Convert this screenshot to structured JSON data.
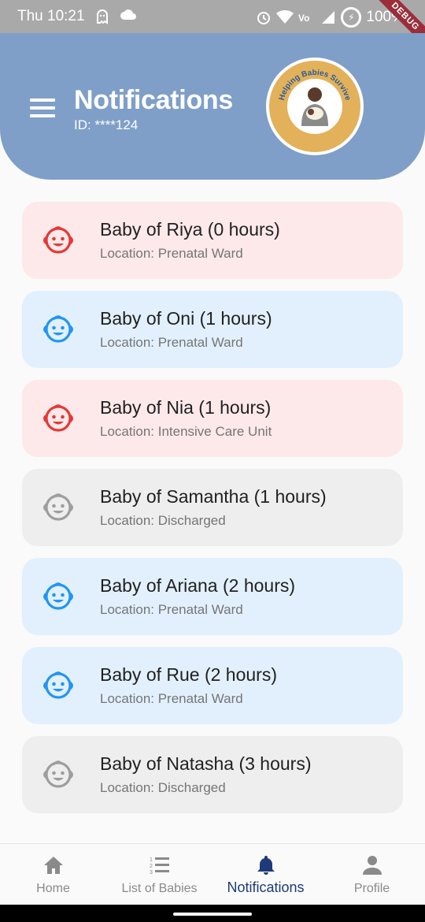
{
  "status_bar": {
    "time": "Thu 10:21",
    "battery": "100%",
    "debug_ribbon": "DEBUG"
  },
  "header": {
    "title": "Notifications",
    "id_label": "ID: ****124",
    "logo_text": "Helping Babies Survive",
    "background_color": "#7f9fc9"
  },
  "notifications": [
    {
      "title": "Baby of Riya (0 hours)",
      "location": "Location: Prenatal Ward",
      "status": "red",
      "icon": "baby-face-icon"
    },
    {
      "title": "Baby of Oni (1 hours)",
      "location": "Location: Prenatal Ward",
      "status": "blue",
      "icon": "baby-face-icon"
    },
    {
      "title": "Baby of Nia (1 hours)",
      "location": "Location: Intensive Care Unit",
      "status": "red",
      "icon": "baby-face-icon"
    },
    {
      "title": "Baby of Samantha (1 hours)",
      "location": "Location: Discharged",
      "status": "grey",
      "icon": "baby-face-icon"
    },
    {
      "title": "Baby of Ariana (2 hours)",
      "location": "Location: Prenatal Ward",
      "status": "blue",
      "icon": "baby-face-icon"
    },
    {
      "title": "Baby of Rue (2 hours)",
      "location": "Location: Prenatal Ward",
      "status": "blue",
      "icon": "baby-face-icon"
    },
    {
      "title": "Baby of Natasha (3 hours)",
      "location": "Location: Discharged",
      "status": "grey",
      "icon": "baby-face-icon"
    }
  ],
  "status_colors": {
    "red": "#e53935",
    "blue": "#2196f3",
    "grey": "#9e9e9e"
  },
  "bottom_nav": {
    "items": [
      {
        "label": "Home",
        "icon": "home-icon",
        "active": false
      },
      {
        "label": "List of Babies",
        "icon": "list-icon",
        "active": false
      },
      {
        "label": "Notifications",
        "icon": "bell-icon",
        "active": true
      },
      {
        "label": "Profile",
        "icon": "person-icon",
        "active": false
      }
    ],
    "active_color": "#1e3a78",
    "inactive_color": "#8a8a8a"
  }
}
